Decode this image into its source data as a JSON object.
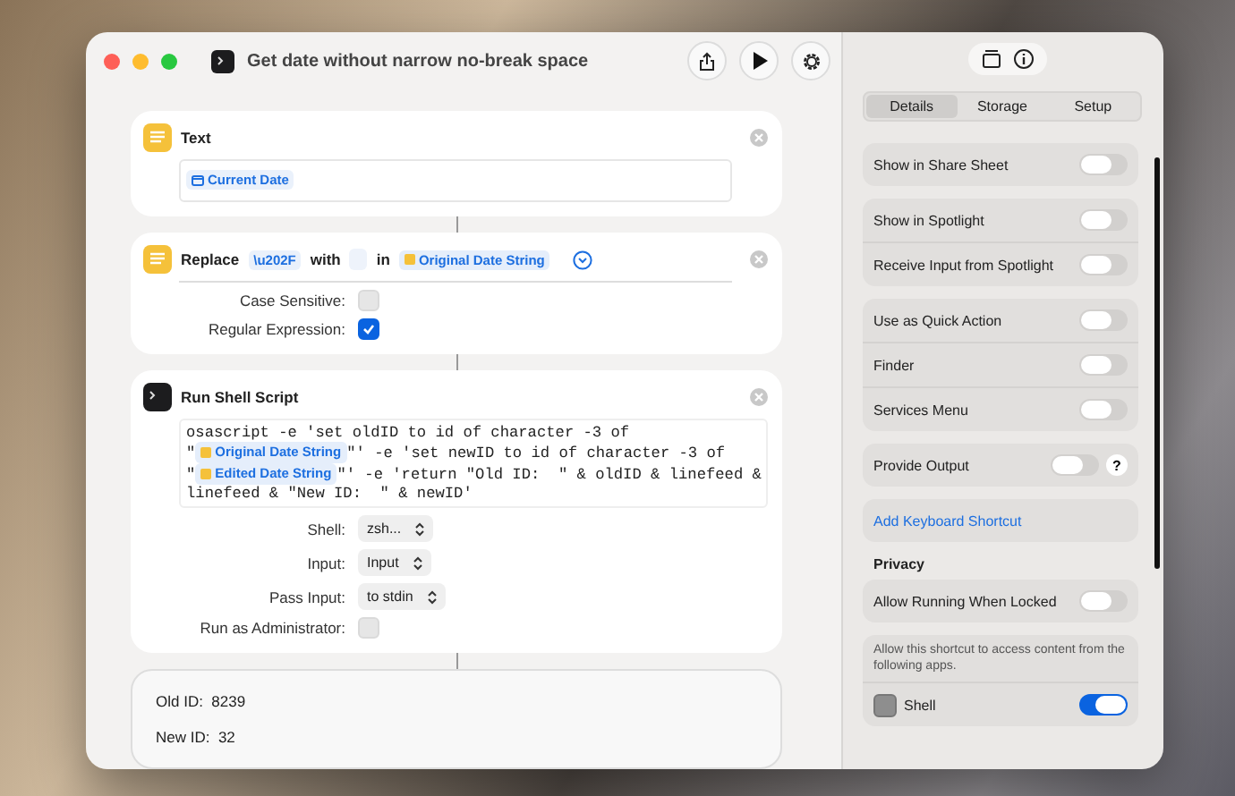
{
  "window": {
    "title": "Get date without narrow no-break space"
  },
  "actions": [
    {
      "kind": "text",
      "title": "Text",
      "tokens": [
        {
          "kind": "date_variable",
          "text": "Current Date"
        }
      ]
    },
    {
      "kind": "replace",
      "parts": [
        {
          "kind": "label",
          "text": "Replace"
        },
        {
          "kind": "value",
          "text": "\\u202F"
        },
        {
          "kind": "label",
          "text": "with"
        },
        {
          "kind": "blank"
        },
        {
          "kind": "label",
          "text": "in"
        },
        {
          "kind": "variable",
          "text": "Original Date String"
        }
      ],
      "options": [
        {
          "kind": "checkbox",
          "label": "Case Sensitive:",
          "checked": false
        },
        {
          "kind": "checkbox",
          "label": "Regular Expression:",
          "checked": true
        }
      ]
    },
    {
      "kind": "shell",
      "title": "Run Shell Script",
      "script": [
        [
          {
            "kind": "code",
            "text": "osascript -e 'set oldID to id of character -3 of"
          }
        ],
        [
          {
            "kind": "code",
            "text": "\""
          },
          {
            "kind": "variable",
            "text": "Original Date String"
          },
          {
            "kind": "code",
            "text": "\"' -e 'set newID to id of character -3 of"
          }
        ],
        [
          {
            "kind": "code",
            "text": "\""
          },
          {
            "kind": "variable",
            "text": "Edited Date String"
          },
          {
            "kind": "code",
            "text": "\"' -e 'return \"Old ID:  \" & oldID & linefeed &"
          }
        ],
        [
          {
            "kind": "code",
            "text": "linefeed & \"New ID:  \" & newID'"
          }
        ]
      ],
      "options": [
        {
          "kind": "popup",
          "label": "Shell:",
          "value": "zsh..."
        },
        {
          "kind": "popup",
          "label": "Input:",
          "value": "Input"
        },
        {
          "kind": "popup",
          "label": "Pass Input:",
          "value": "to stdin"
        },
        {
          "kind": "checkbox",
          "label": "Run as Administrator:",
          "checked": false
        }
      ]
    }
  ],
  "result": {
    "lines": [
      "Old ID:  8239",
      "New ID:  32"
    ]
  },
  "sidebar": {
    "tabs": [
      {
        "label": "Details",
        "selected": true
      },
      {
        "label": "Storage",
        "selected": false
      },
      {
        "label": "Setup",
        "selected": false
      }
    ],
    "groups": [
      {
        "rows": [
          {
            "kind": "toggle",
            "label": "Show in Share Sheet",
            "on": false
          }
        ]
      },
      {
        "rows": [
          {
            "kind": "toggle",
            "label": "Show in Spotlight",
            "on": false
          },
          {
            "kind": "toggle",
            "label": "Receive Input from Spotlight",
            "on": false
          }
        ]
      },
      {
        "rows": [
          {
            "kind": "toggle",
            "label": "Use as Quick Action",
            "on": false
          },
          {
            "kind": "toggle",
            "label": "Finder",
            "on": false
          },
          {
            "kind": "toggle",
            "label": "Services Menu",
            "on": false
          }
        ]
      },
      {
        "rows": [
          {
            "kind": "toggle",
            "label": "Provide Output",
            "on": false,
            "help": "?"
          }
        ]
      },
      {
        "rows": [
          {
            "kind": "link",
            "label": "Add Keyboard Shortcut"
          }
        ]
      },
      {
        "heading": "Privacy",
        "rows": [
          {
            "kind": "toggle",
            "label": "Allow Running When Locked",
            "on": false
          }
        ]
      },
      {
        "rows": [
          {
            "kind": "note",
            "label": "Allow this shortcut to access content from the following apps."
          },
          {
            "kind": "app",
            "label": "Shell",
            "on": true
          }
        ]
      }
    ]
  }
}
